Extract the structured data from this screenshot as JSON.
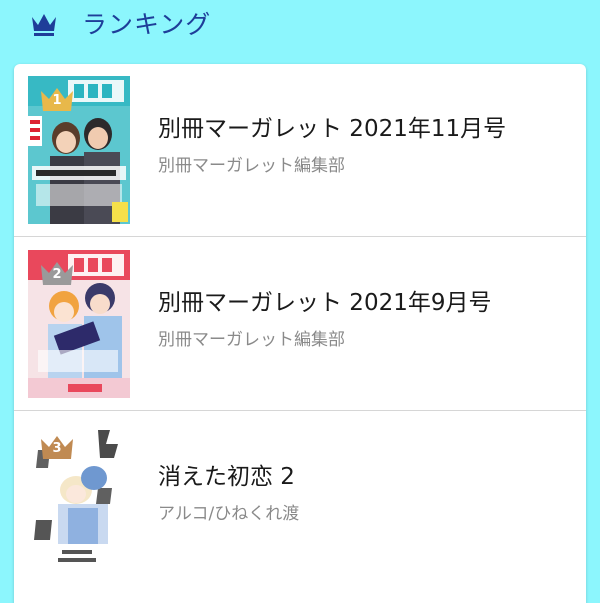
{
  "header": {
    "title": "ランキング",
    "icon": "crown-icon",
    "accent_color": "#1e3e99",
    "background_color": "#8cf6fd"
  },
  "ranking": [
    {
      "rank": "1",
      "badge_color": "#e8b84a",
      "title": "別冊マーガレット 2021年11月号",
      "author": "別冊マーガレット編集部",
      "cover_icon": "magazine-cover"
    },
    {
      "rank": "2",
      "badge_color": "#9a9a9a",
      "title": "別冊マーガレット 2021年9月号",
      "author": "別冊マーガレット編集部",
      "cover_icon": "magazine-cover"
    },
    {
      "rank": "3",
      "badge_color": "#c08a52",
      "title": "消えた初恋 2",
      "author": "アルコ/ひねくれ渡",
      "cover_icon": "comic-cover"
    }
  ]
}
